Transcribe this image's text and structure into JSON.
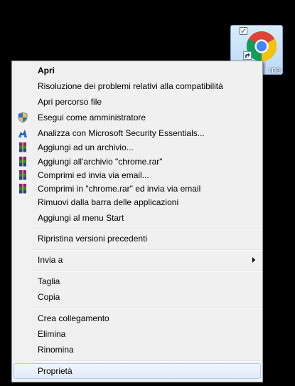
{
  "desktop_icon": {
    "label": "me",
    "checkbox_mark": "✓",
    "icon": "chrome-icon"
  },
  "menu": {
    "items": [
      {
        "id": "open",
        "label": "Apri",
        "bold": true,
        "icon": null
      },
      {
        "id": "troubleshoot-compat",
        "label": "Risoluzione dei problemi relativi alla compatibilità",
        "icon": null
      },
      {
        "id": "open-file-location",
        "label": "Apri percorso file",
        "icon": null
      },
      {
        "id": "run-as-admin",
        "label": "Esegui come amministratore",
        "icon": "uac-shield-icon"
      },
      {
        "id": "scan-mse",
        "label": "Analizza con Microsoft Security Essentials...",
        "icon": "mse-icon"
      },
      {
        "id": "add-to-archive",
        "label": "Aggiungi ad un archivio...",
        "icon": "winrar-icon"
      },
      {
        "id": "add-to-chrome-rar",
        "label": "Aggiungi all'archivio \"chrome.rar\"",
        "icon": "winrar-icon"
      },
      {
        "id": "compress-email",
        "label": "Comprimi ed invia via email...",
        "icon": "winrar-icon"
      },
      {
        "id": "compress-chrome-rar-email",
        "label": "Comprimi in \"chrome.rar\" ed invia via email",
        "icon": "winrar-icon"
      },
      {
        "id": "unpin-taskbar",
        "label": "Rimuovi dalla barra delle applicazioni",
        "icon": null
      },
      {
        "id": "pin-start",
        "label": "Aggiungi al menu Start",
        "icon": null
      },
      {
        "id": "restore-previous",
        "label": "Ripristina versioni precedenti",
        "icon": null
      },
      {
        "id": "send-to",
        "label": "Invia a",
        "submenu": true,
        "icon": null
      },
      {
        "id": "cut",
        "label": "Taglia",
        "icon": null
      },
      {
        "id": "copy",
        "label": "Copia",
        "icon": null
      },
      {
        "id": "create-shortcut",
        "label": "Crea collegamento",
        "icon": null
      },
      {
        "id": "delete",
        "label": "Elimina",
        "icon": null
      },
      {
        "id": "rename",
        "label": "Rinomina",
        "icon": null
      },
      {
        "id": "properties",
        "label": "Proprietà",
        "highlighted": true,
        "icon": null
      }
    ]
  },
  "colors": {
    "menu_bg": "#f0f0f0",
    "menu_border": "#979797",
    "highlight_border": "#aeccf1",
    "desktop_bg": "#000000"
  }
}
